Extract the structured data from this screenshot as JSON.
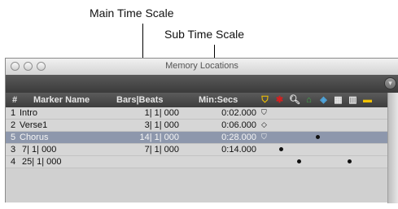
{
  "callouts": {
    "main_time_scale": "Main Time Scale",
    "sub_time_scale": "Sub Time Scale"
  },
  "window": {
    "title": "Memory Locations"
  },
  "columns": {
    "number": "#",
    "marker_name": "Marker Name",
    "bars_beats": "Bars|Beats",
    "min_secs": "Min:Secs"
  },
  "header_icons": [
    "zoom-settings-icon",
    "pre-post-roll-icon",
    "zoom-icon",
    "track-show-hide-icon",
    "track-height-icon",
    "group-enables-icon",
    "window-config-icon",
    "comments-icon"
  ],
  "colors": {
    "header_bg": "#4a4a4a",
    "row_bg": "#d6d6d6",
    "selected_row_bg": "#8d97ac",
    "marker_yellow": "#f2c200",
    "record_red": "#d42020"
  },
  "rows": [
    {
      "num": "1",
      "name": "Intro",
      "bars": "1| 1| 000",
      "mins": "0:02.000",
      "selected": false,
      "marks": [
        "marker-glyph"
      ]
    },
    {
      "num": "2",
      "name": "Verse1",
      "bars": "3| 1| 000",
      "mins": "0:06.000",
      "selected": false,
      "marks": [
        "selection-glyph"
      ]
    },
    {
      "num": "5",
      "name": "Chorus",
      "bars": "14| 1| 000",
      "mins": "0:28.000",
      "selected": true,
      "marks": [
        "marker-glyph",
        "dot-track-height"
      ]
    },
    {
      "num": "3",
      "name": "7| 1| 000",
      "bars": "7| 1| 000",
      "mins": "0:14.000",
      "selected": false,
      "marks": [
        "dot-prepost"
      ]
    },
    {
      "num": "4",
      "name": "25| 1| 000",
      "bars": "",
      "mins": "",
      "selected": false,
      "marks": [
        "dot-zoom",
        "dot-group"
      ]
    }
  ]
}
